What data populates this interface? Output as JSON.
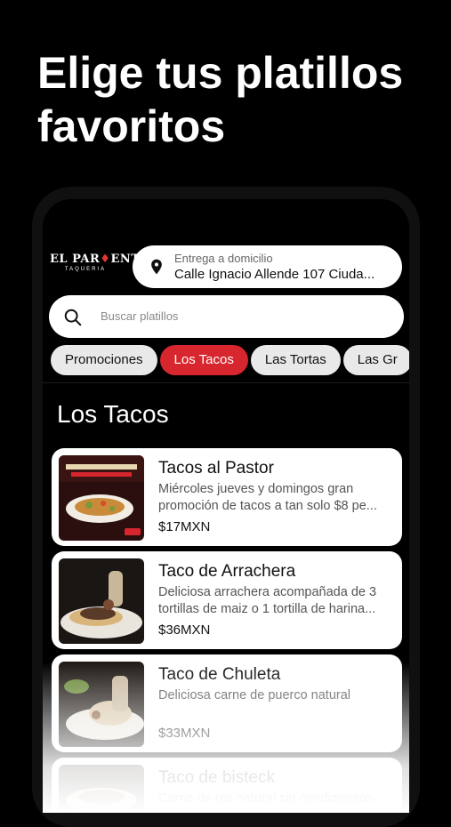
{
  "headline": "Elige tus platillos favoritos",
  "logo": {
    "brand_left": "EL PAR",
    "brand_right": "ENTE",
    "subtitle": "TAQUERIA"
  },
  "delivery": {
    "label": "Entrega a domicilio",
    "address": "Calle Ignacio Allende 107 Ciuda..."
  },
  "search": {
    "placeholder": "Buscar platillos"
  },
  "categories": [
    "Promociones",
    "Los Tacos",
    "Las Tortas",
    "Las Gr"
  ],
  "active_category": "Los Tacos",
  "section_title": "Los Tacos",
  "products": [
    {
      "name": "Tacos al Pastor",
      "description": "Miércoles jueves y domingos gran promoción de tacos a tan solo $8 pe...",
      "price": "$17MXN",
      "image": "tacos-pastor-promo-image"
    },
    {
      "name": "Taco de Arrachera",
      "description": "Deliciosa arrachera acompañada de 3 tortillas de maiz o 1 tortilla de harina...",
      "price": "$36MXN",
      "image": "taco-arrachera-image"
    },
    {
      "name": "Taco de Chuleta",
      "description": "Deliciosa carne de puerco natural",
      "price": "$33MXN",
      "image": "taco-chuleta-image"
    },
    {
      "name": "Taco de bisteck",
      "description": "Carne de res natural sin condimentos",
      "price": "",
      "image": "taco-bisteck-image"
    }
  ],
  "colors": {
    "accent": "#d7262d",
    "background": "#000000",
    "card": "#ffffff",
    "chip": "#e9e9e9"
  }
}
